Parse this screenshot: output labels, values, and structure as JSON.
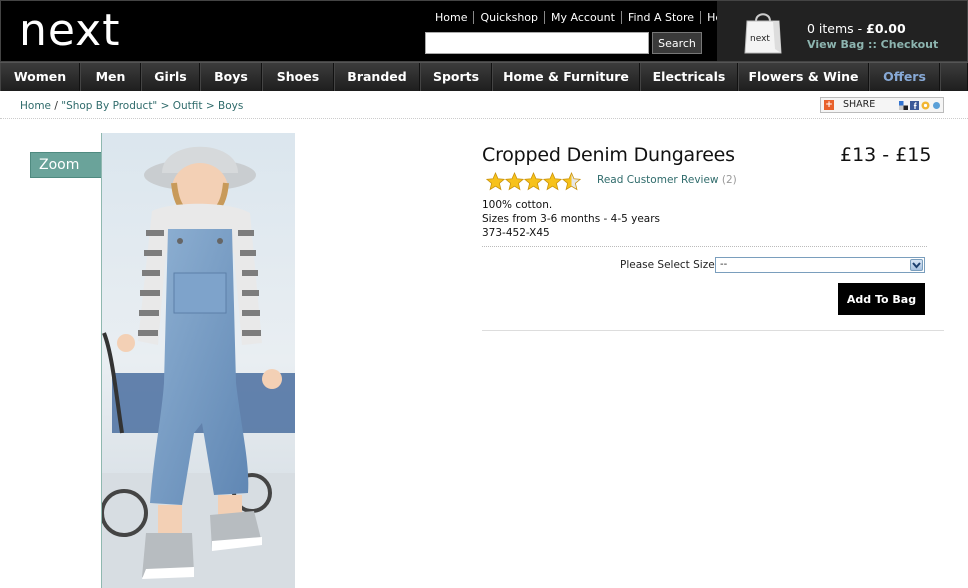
{
  "header": {
    "logo": "next",
    "top_links": [
      "Home",
      "Quickshop",
      "My Account",
      "Find A Store",
      "Help"
    ],
    "search": {
      "value": "",
      "placeholder": "",
      "button_label": "Search"
    },
    "bag": {
      "items_text": "0 items - ",
      "total": "£0.00",
      "links": "View Bag :: Checkout",
      "icon_text": "next"
    }
  },
  "nav": {
    "items": [
      "Women",
      "Men",
      "Girls",
      "Boys",
      "Shoes",
      "Branded",
      "Sports",
      "Home & Furniture",
      "Electricals",
      "Flowers & Wine",
      "Offers"
    ]
  },
  "breadcrumb": {
    "items": [
      "Home",
      "\"Shop By Product\"",
      "Outfit",
      "Boys"
    ],
    "sep1": " / ",
    "sep": " > "
  },
  "share": {
    "label": "SHARE"
  },
  "product": {
    "zoom_label": "Zoom",
    "title": "Cropped Denim Dungarees",
    "price": "£13 - £15",
    "rating": 4.5,
    "rating_max": 5,
    "review_label": "Read Customer Review",
    "review_count": "(2)",
    "desc_line1": "100% cotton.",
    "desc_line2": "Sizes from 3-6 months - 4-5 years",
    "code": "373-452-X45",
    "size_label": "Please Select Size:",
    "size_selected": "--",
    "add_button": "Add To Bag"
  },
  "colors": {
    "accent": "#2f6b6b",
    "zoom_bg": "#6aa39a",
    "offers": "#87a9d6",
    "star": "#f7c21b"
  }
}
